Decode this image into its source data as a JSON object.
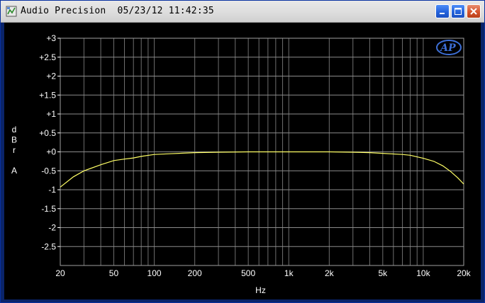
{
  "window": {
    "title": "Audio Precision  05/23/12 11:42:35",
    "minimize_icon": "minimize-icon",
    "maximize_icon": "maximize-icon",
    "close_icon": "close-icon"
  },
  "chart_data": {
    "type": "line",
    "xscale": "log",
    "xlim": [
      20,
      20000
    ],
    "ylim": [
      -3,
      3
    ],
    "ylabel": [
      "d",
      "B",
      "r",
      "",
      "A"
    ],
    "xlabel": "Hz",
    "grid": true,
    "y_ticks": [
      {
        "v": 3,
        "label": "+3"
      },
      {
        "v": 2.5,
        "label": "+2.5"
      },
      {
        "v": 2,
        "label": "+2"
      },
      {
        "v": 1.5,
        "label": "+1.5"
      },
      {
        "v": 1,
        "label": "+1"
      },
      {
        "v": 0.5,
        "label": "+0.5"
      },
      {
        "v": 0,
        "label": "+0"
      },
      {
        "v": -0.5,
        "label": "-0.5"
      },
      {
        "v": -1,
        "label": "-1"
      },
      {
        "v": -1.5,
        "label": "-1.5"
      },
      {
        "v": -2,
        "label": "-2"
      },
      {
        "v": -2.5,
        "label": "-2.5"
      }
    ],
    "x_ticks": [
      {
        "v": 20,
        "label": "20"
      },
      {
        "v": 50,
        "label": "50"
      },
      {
        "v": 100,
        "label": "100"
      },
      {
        "v": 200,
        "label": "200"
      },
      {
        "v": 500,
        "label": "500"
      },
      {
        "v": 1000,
        "label": "1k"
      },
      {
        "v": 2000,
        "label": "2k"
      },
      {
        "v": 5000,
        "label": "5k"
      },
      {
        "v": 10000,
        "label": "10k"
      },
      {
        "v": 20000,
        "label": "20k"
      }
    ],
    "series": [
      {
        "color": "#ffff66",
        "points": [
          [
            20,
            -0.93
          ],
          [
            25,
            -0.66
          ],
          [
            30,
            -0.5
          ],
          [
            40,
            -0.34
          ],
          [
            50,
            -0.23
          ],
          [
            60,
            -0.19
          ],
          [
            70,
            -0.16
          ],
          [
            80,
            -0.12
          ],
          [
            100,
            -0.07
          ],
          [
            130,
            -0.05
          ],
          [
            200,
            -0.02
          ],
          [
            300,
            -0.01
          ],
          [
            500,
            0.0
          ],
          [
            1000,
            0.0
          ],
          [
            2000,
            0.0
          ],
          [
            3000,
            -0.01
          ],
          [
            4000,
            -0.02
          ],
          [
            5000,
            -0.04
          ],
          [
            7000,
            -0.07
          ],
          [
            8000,
            -0.09
          ],
          [
            10000,
            -0.17
          ],
          [
            12000,
            -0.25
          ],
          [
            14000,
            -0.37
          ],
          [
            16000,
            -0.52
          ],
          [
            18000,
            -0.68
          ],
          [
            20000,
            -0.85
          ]
        ]
      }
    ],
    "logo": "ap-logo-icon",
    "logo_text": "AP"
  },
  "colors": {
    "grid_major": "#8c8c8c",
    "grid_minor": "#6e6e6e",
    "trace": "#ffff66",
    "background": "#000000",
    "logo": "#3d6fd6"
  }
}
